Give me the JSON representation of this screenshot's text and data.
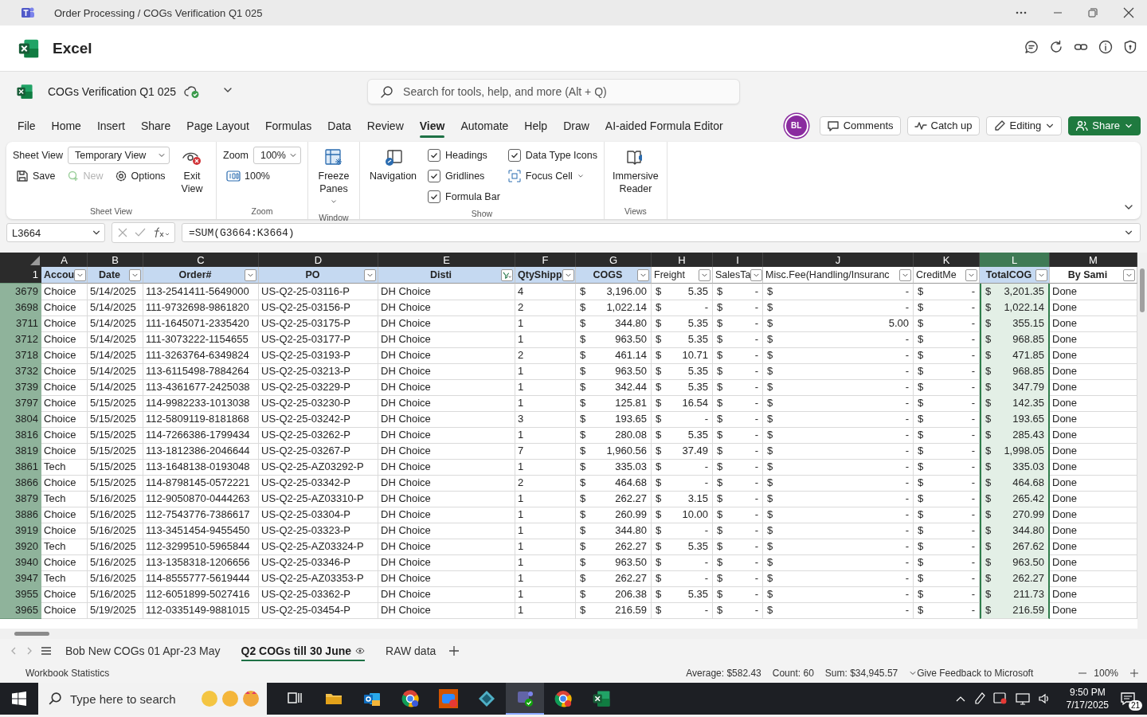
{
  "window": {
    "title": "Order Processing / COGs Verification Q1 025"
  },
  "app": {
    "name": "Excel"
  },
  "document": {
    "name": "COGs Verification Q1 025",
    "saved": true
  },
  "search": {
    "placeholder": "Search for tools, help, and more (Alt + Q)"
  },
  "menu_tabs": [
    {
      "label": "File",
      "selected": false
    },
    {
      "label": "Home",
      "selected": false
    },
    {
      "label": "Insert",
      "selected": false
    },
    {
      "label": "Share",
      "selected": false
    },
    {
      "label": "Page Layout",
      "selected": false
    },
    {
      "label": "Formulas",
      "selected": false
    },
    {
      "label": "Data",
      "selected": false
    },
    {
      "label": "Review",
      "selected": false
    },
    {
      "label": "View",
      "selected": true
    },
    {
      "label": "Automate",
      "selected": false
    },
    {
      "label": "Help",
      "selected": false
    },
    {
      "label": "Draw",
      "selected": false
    },
    {
      "label": "AI-aided Formula Editor",
      "selected": false
    }
  ],
  "user": {
    "initials": "BL"
  },
  "actions": [
    {
      "label": "Comments",
      "kind": "comments"
    },
    {
      "label": "Catch up",
      "kind": "catchup"
    },
    {
      "label": "Editing",
      "kind": "editing"
    },
    {
      "label": "Share",
      "kind": "share"
    }
  ],
  "ribbon": {
    "groups": [
      {
        "kind": "sheet_view",
        "label": "Sheet View",
        "view_label": "Sheet View",
        "view_value": "Temporary View",
        "buttons": [
          {
            "label": "Save",
            "kind": "save",
            "disabled": false
          },
          {
            "label": "New",
            "kind": "new",
            "disabled": true
          },
          {
            "label": "Options",
            "kind": "options",
            "disabled": false
          }
        ],
        "big_button": "Exit View"
      },
      {
        "kind": "zoom",
        "label": "Zoom",
        "zoom_label": "Zoom",
        "zoom_value": "100%",
        "button": "100%"
      },
      {
        "kind": "window",
        "label": "Window",
        "big_button": "Freeze Panes"
      },
      {
        "kind": "show",
        "label": "Show",
        "big_button": "Navigation",
        "checkboxes": [
          {
            "label": "Headings",
            "checked": true
          },
          {
            "label": "Gridlines",
            "checked": true
          },
          {
            "label": "Formula Bar",
            "checked": true
          },
          {
            "label": "Data Type Icons",
            "checked": true
          }
        ],
        "button": "Focus Cell"
      },
      {
        "kind": "views",
        "label": "Views",
        "big_button": "Immersive Reader"
      }
    ]
  },
  "formula_bar": {
    "name_box": "L3664",
    "formula": "=SUM(G3664:K3664)"
  },
  "sheet": {
    "columns": [
      {
        "letter": "A",
        "selected": false
      },
      {
        "letter": "B",
        "selected": false
      },
      {
        "letter": "C",
        "selected": false
      },
      {
        "letter": "D",
        "selected": false
      },
      {
        "letter": "E",
        "selected": false
      },
      {
        "letter": "F",
        "selected": false
      },
      {
        "letter": "G",
        "selected": false
      },
      {
        "letter": "H",
        "selected": false
      },
      {
        "letter": "I",
        "selected": false
      },
      {
        "letter": "J",
        "selected": false
      },
      {
        "letter": "K",
        "selected": false
      },
      {
        "letter": "L",
        "selected": true
      },
      {
        "letter": "M",
        "selected": false
      }
    ],
    "header_row": "1",
    "headers": [
      {
        "label": "Accou",
        "highlighted": true,
        "bold": true,
        "filtered": false
      },
      {
        "label": "Date",
        "highlighted": true,
        "bold": true,
        "filtered": false
      },
      {
        "label": "Order#",
        "highlighted": true,
        "bold": true,
        "filtered": false
      },
      {
        "label": "PO",
        "highlighted": true,
        "bold": true,
        "filtered": false
      },
      {
        "label": "Disti",
        "highlighted": true,
        "bold": true,
        "filtered": true
      },
      {
        "label": "QtyShipp",
        "highlighted": true,
        "bold": true,
        "filtered": false
      },
      {
        "label": "COGS",
        "highlighted": true,
        "bold": true,
        "filtered": false
      },
      {
        "label": "Freight",
        "highlighted": false,
        "bold": false,
        "filtered": false
      },
      {
        "label": "SalesTa",
        "highlighted": false,
        "bold": false,
        "filtered": false
      },
      {
        "label": "Misc.Fee(Handling/Insuranc",
        "highlighted": false,
        "bold": false,
        "filtered": false
      },
      {
        "label": "CreditMe",
        "highlighted": false,
        "bold": false,
        "filtered": false
      },
      {
        "label": "TotalCOG",
        "highlighted": true,
        "bold": true,
        "filtered": false
      },
      {
        "label": "By Sami",
        "highlighted": false,
        "bold": true,
        "filtered": false
      }
    ],
    "rows": [
      {
        "num": "3679",
        "cells": [
          "Choice",
          "5/14/2025",
          "113-2541411-5649000",
          "US-Q2-25-03116-P",
          "DH Choice",
          "4",
          [
            "$",
            "3,196.00"
          ],
          [
            "$",
            "5.35"
          ],
          [
            "$",
            "-"
          ],
          [
            "$",
            "-"
          ],
          [
            "$",
            "-"
          ],
          [
            "$",
            "3,201.35"
          ],
          "Done"
        ]
      },
      {
        "num": "3698",
        "cells": [
          "Choice",
          "5/14/2025",
          "111-9732698-9861820",
          "US-Q2-25-03156-P",
          "DH Choice",
          "2",
          [
            "$",
            "1,022.14"
          ],
          [
            "$",
            "-"
          ],
          [
            "$",
            "-"
          ],
          [
            "$",
            "-"
          ],
          [
            "$",
            "-"
          ],
          [
            "$",
            "1,022.14"
          ],
          "Done"
        ]
      },
      {
        "num": "3711",
        "cells": [
          "Choice",
          "5/14/2025",
          "111-1645071-2335420",
          "US-Q2-25-03175-P",
          "DH Choice",
          "1",
          [
            "$",
            "344.80"
          ],
          [
            "$",
            "5.35"
          ],
          [
            "$",
            "-"
          ],
          [
            "$",
            "5.00"
          ],
          [
            "$",
            "-"
          ],
          [
            "$",
            "355.15"
          ],
          "Done"
        ]
      },
      {
        "num": "3712",
        "cells": [
          "Choice",
          "5/14/2025",
          "111-3073222-1154655",
          "US-Q2-25-03177-P",
          "DH Choice",
          "1",
          [
            "$",
            "963.50"
          ],
          [
            "$",
            "5.35"
          ],
          [
            "$",
            "-"
          ],
          [
            "$",
            "-"
          ],
          [
            "$",
            "-"
          ],
          [
            "$",
            "968.85"
          ],
          "Done"
        ]
      },
      {
        "num": "3718",
        "cells": [
          "Choice",
          "5/14/2025",
          "111-3263764-6349824",
          "US-Q2-25-03193-P",
          "DH Choice",
          "2",
          [
            "$",
            "461.14"
          ],
          [
            "$",
            "10.71"
          ],
          [
            "$",
            "-"
          ],
          [
            "$",
            "-"
          ],
          [
            "$",
            "-"
          ],
          [
            "$",
            "471.85"
          ],
          "Done"
        ]
      },
      {
        "num": "3732",
        "cells": [
          "Choice",
          "5/14/2025",
          "113-6115498-7884264",
          "US-Q2-25-03213-P",
          "DH Choice",
          "1",
          [
            "$",
            "963.50"
          ],
          [
            "$",
            "5.35"
          ],
          [
            "$",
            "-"
          ],
          [
            "$",
            "-"
          ],
          [
            "$",
            "-"
          ],
          [
            "$",
            "968.85"
          ],
          "Done"
        ]
      },
      {
        "num": "3739",
        "cells": [
          "Choice",
          "5/14/2025",
          "113-4361677-2425038",
          "US-Q2-25-03229-P",
          "DH Choice",
          "1",
          [
            "$",
            "342.44"
          ],
          [
            "$",
            "5.35"
          ],
          [
            "$",
            "-"
          ],
          [
            "$",
            "-"
          ],
          [
            "$",
            "-"
          ],
          [
            "$",
            "347.79"
          ],
          "Done"
        ]
      },
      {
        "num": "3797",
        "cells": [
          "Choice",
          "5/15/2025",
          "114-9982233-1013038",
          "US-Q2-25-03230-P",
          "DH Choice",
          "1",
          [
            "$",
            "125.81"
          ],
          [
            "$",
            "16.54"
          ],
          [
            "$",
            "-"
          ],
          [
            "$",
            "-"
          ],
          [
            "$",
            "-"
          ],
          [
            "$",
            "142.35"
          ],
          "Done"
        ]
      },
      {
        "num": "3804",
        "cells": [
          "Choice",
          "5/15/2025",
          "112-5809119-8181868",
          "US-Q2-25-03242-P",
          "DH Choice",
          "3",
          [
            "$",
            "193.65"
          ],
          [
            "$",
            "-"
          ],
          [
            "$",
            "-"
          ],
          [
            "$",
            "-"
          ],
          [
            "$",
            "-"
          ],
          [
            "$",
            "193.65"
          ],
          "Done"
        ]
      },
      {
        "num": "3816",
        "cells": [
          "Choice",
          "5/15/2025",
          "114-7266386-1799434",
          "US-Q2-25-03262-P",
          "DH Choice",
          "1",
          [
            "$",
            "280.08"
          ],
          [
            "$",
            "5.35"
          ],
          [
            "$",
            "-"
          ],
          [
            "$",
            "-"
          ],
          [
            "$",
            "-"
          ],
          [
            "$",
            "285.43"
          ],
          "Done"
        ]
      },
      {
        "num": "3819",
        "cells": [
          "Choice",
          "5/15/2025",
          "113-1812386-2046644",
          "US-Q2-25-03267-P",
          "DH Choice",
          "7",
          [
            "$",
            "1,960.56"
          ],
          [
            "$",
            "37.49"
          ],
          [
            "$",
            "-"
          ],
          [
            "$",
            "-"
          ],
          [
            "$",
            "-"
          ],
          [
            "$",
            "1,998.05"
          ],
          "Done"
        ]
      },
      {
        "num": "3861",
        "cells": [
          "Tech",
          "5/15/2025",
          "113-1648138-0193048",
          "US-Q2-25-AZ03292-P",
          "DH Choice",
          "1",
          [
            "$",
            "335.03"
          ],
          [
            "$",
            "-"
          ],
          [
            "$",
            "-"
          ],
          [
            "$",
            "-"
          ],
          [
            "$",
            "-"
          ],
          [
            "$",
            "335.03"
          ],
          "Done"
        ]
      },
      {
        "num": "3866",
        "cells": [
          "Choice",
          "5/15/2025",
          "114-8798145-0572221",
          "US-Q2-25-03342-P",
          "DH Choice",
          "2",
          [
            "$",
            "464.68"
          ],
          [
            "$",
            "-"
          ],
          [
            "$",
            "-"
          ],
          [
            "$",
            "-"
          ],
          [
            "$",
            "-"
          ],
          [
            "$",
            "464.68"
          ],
          "Done"
        ]
      },
      {
        "num": "3879",
        "cells": [
          "Tech",
          "5/16/2025",
          "112-9050870-0444263",
          "US-Q2-25-AZ03310-P",
          "DH Choice",
          "1",
          [
            "$",
            "262.27"
          ],
          [
            "$",
            "3.15"
          ],
          [
            "$",
            "-"
          ],
          [
            "$",
            "-"
          ],
          [
            "$",
            "-"
          ],
          [
            "$",
            "265.42"
          ],
          "Done"
        ]
      },
      {
        "num": "3886",
        "cells": [
          "Choice",
          "5/16/2025",
          "112-7543776-7386617",
          "US-Q2-25-03304-P",
          "DH Choice",
          "1",
          [
            "$",
            "260.99"
          ],
          [
            "$",
            "10.00"
          ],
          [
            "$",
            "-"
          ],
          [
            "$",
            "-"
          ],
          [
            "$",
            "-"
          ],
          [
            "$",
            "270.99"
          ],
          "Done"
        ]
      },
      {
        "num": "3919",
        "cells": [
          "Choice",
          "5/16/2025",
          "113-3451454-9455450",
          "US-Q2-25-03323-P",
          "DH Choice",
          "1",
          [
            "$",
            "344.80"
          ],
          [
            "$",
            "-"
          ],
          [
            "$",
            "-"
          ],
          [
            "$",
            "-"
          ],
          [
            "$",
            "-"
          ],
          [
            "$",
            "344.80"
          ],
          "Done"
        ]
      },
      {
        "num": "3920",
        "cells": [
          "Tech",
          "5/16/2025",
          "112-3299510-5965844",
          "US-Q2-25-AZ03324-P",
          "DH Choice",
          "1",
          [
            "$",
            "262.27"
          ],
          [
            "$",
            "5.35"
          ],
          [
            "$",
            "-"
          ],
          [
            "$",
            "-"
          ],
          [
            "$",
            "-"
          ],
          [
            "$",
            "267.62"
          ],
          "Done"
        ]
      },
      {
        "num": "3940",
        "cells": [
          "Choice",
          "5/16/2025",
          "113-1358318-1206656",
          "US-Q2-25-03346-P",
          "DH Choice",
          "1",
          [
            "$",
            "963.50"
          ],
          [
            "$",
            "-"
          ],
          [
            "$",
            "-"
          ],
          [
            "$",
            "-"
          ],
          [
            "$",
            "-"
          ],
          [
            "$",
            "963.50"
          ],
          "Done"
        ]
      },
      {
        "num": "3947",
        "cells": [
          "Tech",
          "5/16/2025",
          "114-8555777-5619444",
          "US-Q2-25-AZ03353-P",
          "DH Choice",
          "1",
          [
            "$",
            "262.27"
          ],
          [
            "$",
            "-"
          ],
          [
            "$",
            "-"
          ],
          [
            "$",
            "-"
          ],
          [
            "$",
            "-"
          ],
          [
            "$",
            "262.27"
          ],
          "Done"
        ]
      },
      {
        "num": "3955",
        "cells": [
          "Choice",
          "5/16/2025",
          "112-6051899-5027416",
          "US-Q2-25-03362-P",
          "DH Choice",
          "1",
          [
            "$",
            "206.38"
          ],
          [
            "$",
            "5.35"
          ],
          [
            "$",
            "-"
          ],
          [
            "$",
            "-"
          ],
          [
            "$",
            "-"
          ],
          [
            "$",
            "211.73"
          ],
          "Done"
        ]
      },
      {
        "num": "3965",
        "cells": [
          "Choice",
          "5/19/2025",
          "112-0335149-9881015",
          "US-Q2-25-03454-P",
          "DH Choice",
          "1",
          [
            "$",
            "216.59"
          ],
          [
            "$",
            "-"
          ],
          [
            "$",
            "-"
          ],
          [
            "$",
            "-"
          ],
          [
            "$",
            "-"
          ],
          [
            "$",
            "216.59"
          ],
          "Done"
        ]
      }
    ]
  },
  "sheet_tabs": [
    {
      "label": "Bob New COGs 01 Apr-23 May",
      "selected": false
    },
    {
      "label": "Q2 COGs till 30 June",
      "selected": true
    },
    {
      "label": "RAW data",
      "selected": false
    }
  ],
  "status_bar": {
    "left": "Workbook Statistics",
    "average": "Average: $582.43",
    "count": "Count: 60",
    "sum": "Sum: $34,945.57",
    "feedback": "Give Feedback to Microsoft",
    "zoom": "100%"
  },
  "taskbar": {
    "search_placeholder": "Type here to search",
    "time": "9:50 PM",
    "date": "7/17/2025",
    "notifications": "21"
  }
}
